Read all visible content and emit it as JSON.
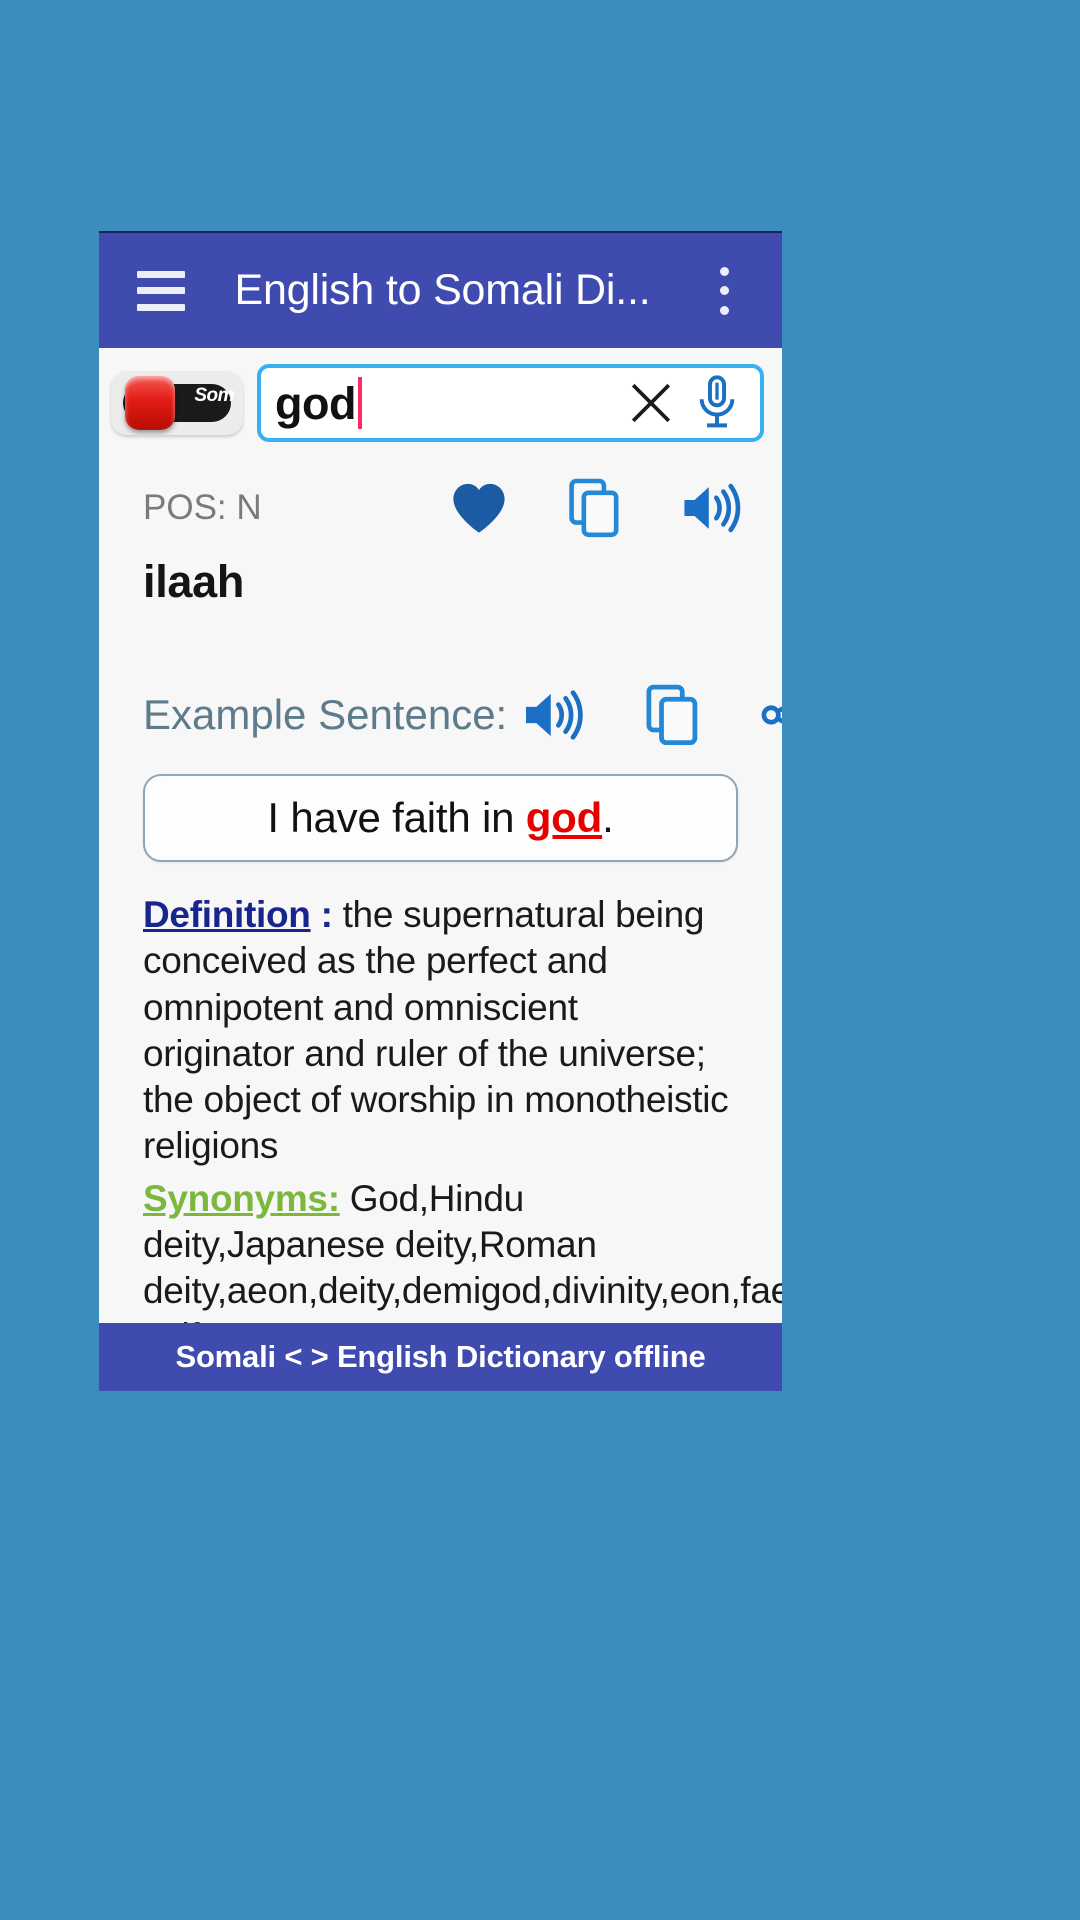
{
  "app": {
    "bar": {
      "menu_icon": "hamburger-menu-icon",
      "title": "English to Somali Di...",
      "overflow_icon": "more-vert-icon"
    },
    "footer": {
      "text": "Somali < > English Dictionary offline"
    }
  },
  "search": {
    "lang_toggle_label": "Som",
    "value": "god",
    "placeholder": "",
    "clear_icon": "close-x-icon",
    "mic_icon": "microphone-icon"
  },
  "entry": {
    "pos_label": "POS: N",
    "headword": "ilaah",
    "actions": {
      "favorite_icon": "heart-filled-icon",
      "copy_icon": "copy-icon",
      "speaker_icon": "speaker-volume-icon"
    }
  },
  "example": {
    "label": "Example Sentence:",
    "speaker_icon": "speaker-volume-icon",
    "copy_icon": "copy-icon",
    "share_icon": "share-icon",
    "sentence_prefix": "I have faith in ",
    "sentence_keyword": "god",
    "sentence_suffix": "."
  },
  "definition": {
    "label": "Definition",
    "separator": " : ",
    "text": "the supernatural being conceived as the perfect and omnipotent and omniscient originator and ruler of the universe; the object of worship in monotheistic religions"
  },
  "synonyms": {
    "label": "Synonyms:",
    "text": " God,Hindu deity,Japanese deity,Roman deity,aeon,deity,demigod,divinity,eon,faerie,faery,fay,golden calf,straw man,strawman,trickster,wax figure,waxwork,zombi,zombie"
  },
  "colors": {
    "page_background": "#3b8dbd",
    "app_bar": "#3f4bae",
    "search_border": "#36b0ef",
    "caret": "#ff2a68",
    "definition_label": "#17258c",
    "synonyms_label": "#7cb83e",
    "keyword_red": "#e60000",
    "icon_blue": "#1b6fc4"
  }
}
